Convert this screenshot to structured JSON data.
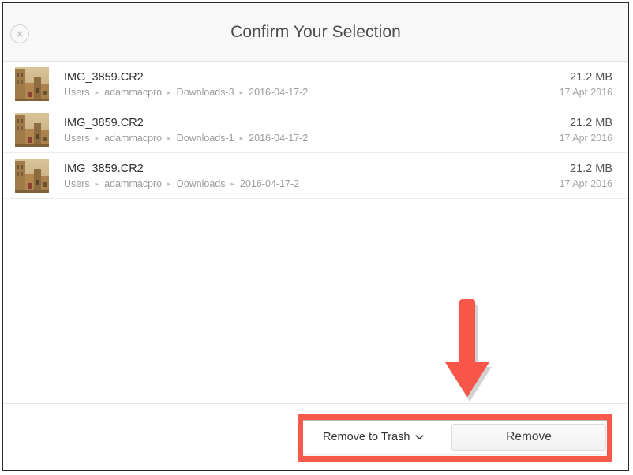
{
  "window": {
    "title": "Confirm Your Selection",
    "close_icon": "close-circle-icon"
  },
  "file_list": {
    "path_separator": "▸",
    "rows": [
      {
        "name": "IMG_3859.CR2",
        "path": [
          "Users",
          "adammacpro",
          "Downloads-3",
          "2016-04-17-2"
        ],
        "size": "21.2 MB",
        "date": "17 Apr 2016",
        "thumbnail": "photo-thumbnail-sepia-architecture"
      },
      {
        "name": "IMG_3859.CR2",
        "path": [
          "Users",
          "adammacpro",
          "Downloads-1",
          "2016-04-17-2"
        ],
        "size": "21.2 MB",
        "date": "17 Apr 2016",
        "thumbnail": "photo-thumbnail-sepia-architecture"
      },
      {
        "name": "IMG_3859.CR2",
        "path": [
          "Users",
          "adammacpro",
          "Downloads",
          "2016-04-17-2"
        ],
        "size": "21.2 MB",
        "date": "17 Apr 2016",
        "thumbnail": "photo-thumbnail-sepia-architecture"
      }
    ]
  },
  "footer": {
    "action_select": {
      "selected": "Remove to Trash",
      "chevron_icon": "chevron-down-icon",
      "options": [
        "Remove to Trash"
      ]
    },
    "remove_button_label": "Remove"
  },
  "annotations": {
    "highlight_color": "#f7594b",
    "arrow_color": "#f9564a",
    "arrow_direction": "down",
    "highlight_target": "footer-controls"
  },
  "colors": {
    "header_background": "#f8f8f8",
    "window_border": "#2b2b2b",
    "divider": "#ececec",
    "title_text": "#4a4a4a",
    "path_text": "#9b9b9b"
  }
}
